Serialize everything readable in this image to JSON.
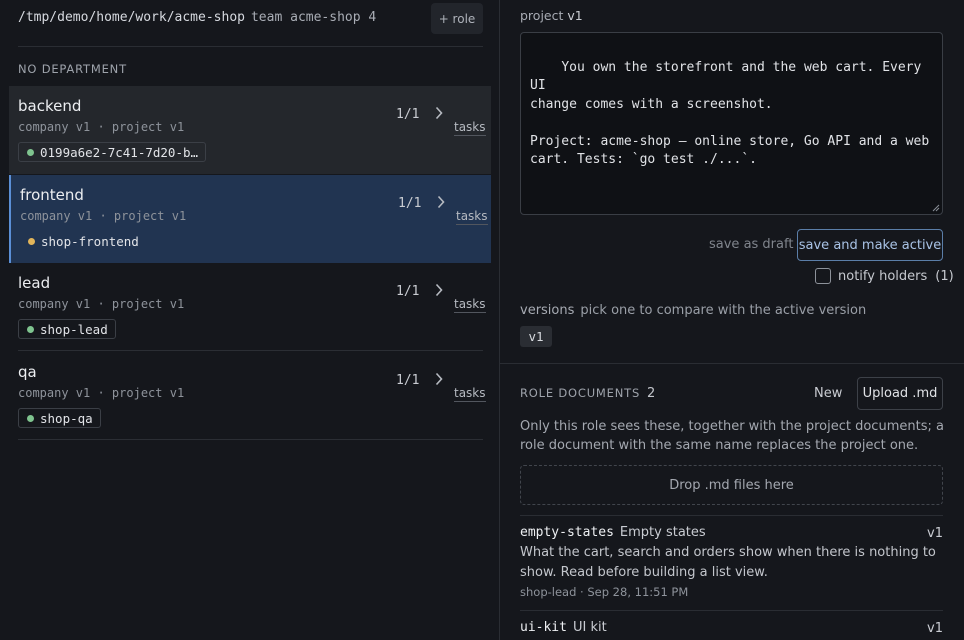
{
  "header": {
    "path": "/tmp/demo/home/work/acme-shop",
    "team_label": "team acme-shop 4",
    "add_role_label": "+ role"
  },
  "department": {
    "label": "NO DEPARTMENT"
  },
  "roles": [
    {
      "name": "backend",
      "meta": "company v1 · project v1",
      "count": "1/1",
      "tasks_label": "tasks",
      "chip": "0199a6e2-7c41-7d20-b…",
      "dot_color": "#7fc48f"
    },
    {
      "name": "frontend",
      "meta": "company v1 · project v1",
      "count": "1/1",
      "tasks_label": "tasks",
      "chip": "shop-frontend",
      "dot_color": "#e2b55a"
    },
    {
      "name": "lead",
      "meta": "company v1 · project v1",
      "count": "1/1",
      "tasks_label": "tasks",
      "chip": "shop-lead",
      "dot_color": "#7fc48f"
    },
    {
      "name": "qa",
      "meta": "company v1 · project v1",
      "count": "1/1",
      "tasks_label": "tasks",
      "chip": "shop-qa",
      "dot_color": "#7fc48f"
    }
  ],
  "editor": {
    "label": "project",
    "version": "v1",
    "content": "You own the storefront and the web cart. Every UI\nchange comes with a screenshot.\n\nProject: acme-shop — online store, Go API and a web\ncart. Tests: `go test ./...`."
  },
  "actions": {
    "draft_label": "save as draft",
    "activate_label": "save and make active",
    "notify_label": "notify holders",
    "notify_count": "(1)"
  },
  "versions": {
    "label": "versions",
    "hint": "pick one to compare with the active version",
    "items": [
      "v1"
    ]
  },
  "documents": {
    "title": "ROLE DOCUMENTS",
    "count": "2",
    "new_label": "New",
    "upload_label": "Upload .md",
    "description": "Only this role sees these, together with the project documents; a role document with the same name replaces the project one.",
    "dropzone_label": "Drop .md files here",
    "items": [
      {
        "name": "empty-states",
        "title": "Empty states",
        "version": "v1",
        "body": "What the cart, search and orders show when there is nothing to show. Read before building a list view.",
        "meta": "shop-lead · Sep 28, 11:51 PM"
      },
      {
        "name": "ui-kit",
        "title": "UI kit",
        "version": "v1"
      }
    ]
  },
  "colors": {
    "accent": "#5b8fd6",
    "selected_bg": "#213451",
    "status_active": "#7fc48f",
    "status_pending": "#e2b55a"
  },
  "icons": [
    "chevron-right-icon",
    "status-dot-icon",
    "resize-handle-icon"
  ]
}
